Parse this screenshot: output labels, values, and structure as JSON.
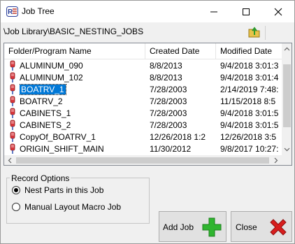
{
  "window": {
    "title": "Job Tree",
    "icon": "app-logo-icon",
    "controls": [
      "minimize-icon",
      "maximize-icon",
      "close-icon"
    ]
  },
  "path_bar": {
    "path": "\\Job Library\\BASIC_NESTING_JOBS",
    "up_icon": "folder-up-icon"
  },
  "list": {
    "columns": [
      "Folder/Program Name",
      "Created Date",
      "Modified Date"
    ],
    "rows": [
      {
        "name": "ALUMINUM_090",
        "created": "8/8/2013",
        "modified": "9/4/2018 3:01:3"
      },
      {
        "name": "ALUMINUM_102",
        "created": "8/8/2013",
        "modified": "9/4/2018 3:01:4"
      },
      {
        "name": "BOATRV_1",
        "created": "7/28/2003",
        "modified": "2/14/2019 7:48:",
        "selected": true
      },
      {
        "name": "BOATRV_2",
        "created": "7/28/2003",
        "modified": "11/15/2018 8:5"
      },
      {
        "name": "CABINETS_1",
        "created": "7/28/2003",
        "modified": "9/4/2018 3:01:5"
      },
      {
        "name": "CABINETS_2",
        "created": "7/28/2003",
        "modified": "9/4/2018 3:01:5"
      },
      {
        "name": "CopyOf_BOATRV_1",
        "created": "12/26/2018 1:2",
        "modified": "12/26/2018 3:5"
      },
      {
        "name": "ORIGIN_SHIFT_MAIN",
        "created": "11/30/2012",
        "modified": "9/8/2017 10:27:"
      }
    ],
    "row_icon": "program-file-icon"
  },
  "record_options": {
    "label": "Record Options",
    "options": [
      {
        "label": "Nest Parts in this Job",
        "checked": true
      },
      {
        "label": "Manual Layout Macro Job",
        "checked": false
      }
    ]
  },
  "buttons": {
    "add_label": "Add Job",
    "add_icon": "green-plus-icon",
    "close_label": "Close",
    "close_icon": "red-x-icon"
  },
  "colors": {
    "selection": "#0078d7",
    "add_green": "#2fb52f",
    "close_red": "#d81e1e"
  }
}
